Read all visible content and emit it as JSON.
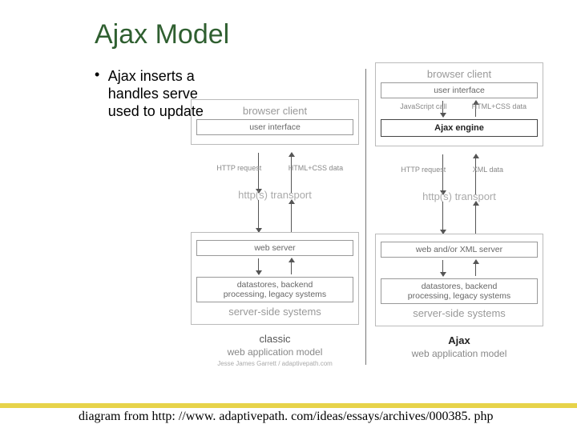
{
  "title": "Ajax Model",
  "bullet": "Ajax inserts a\nhandles serve\nused to update",
  "credit": "diagram from http: //www. adaptivepath. com/ideas/essays/archives/000385. php",
  "classic": {
    "browser_client": "browser client",
    "ui": "user interface",
    "transport": "http(s) transport",
    "req_label": "HTTP request",
    "resp_label": "HTML+CSS data",
    "server_side": "server-side systems",
    "web_server": "web server",
    "backend": "datastores, backend\nprocessing, legacy systems",
    "model_name": "classic",
    "model_sub": "web application model",
    "tiny": "Jesse James Garrett / adaptivepath.com"
  },
  "ajax": {
    "browser_client": "browser client",
    "ui": "user interface",
    "inner_req": "JavaScript call",
    "inner_resp": "HTML+CSS data",
    "engine": "Ajax engine",
    "transport": "http(s) transport",
    "req_label": "HTTP request",
    "resp_label": "XML data",
    "server_side": "server-side systems",
    "web_server": "web and/or XML server",
    "backend": "datastores, backend\nprocessing, legacy systems",
    "model_name": "Ajax",
    "model_sub": "web application model"
  }
}
